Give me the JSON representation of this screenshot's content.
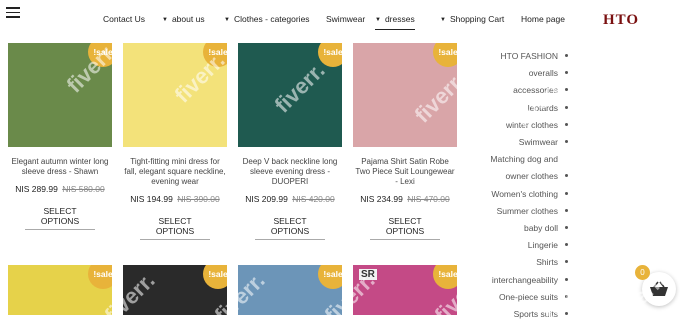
{
  "nav": {
    "contact": "Contact Us",
    "about": "about us",
    "categories": "Clothes - categories",
    "swimwear": "Swimwear",
    "dresses": "dresses",
    "cart": "Shopping Cart",
    "home": "Home page",
    "logo": "HTO"
  },
  "sale_label": "!sale",
  "products": [
    {
      "title": "Elegant autumn winter long sleeve dress - Shawn",
      "price": "NIS 289.99",
      "old_price": "NIS 580.00",
      "button": "SELECT OPTIONS",
      "image_color": "#6a8a4a"
    },
    {
      "title": "Tight-fitting mini dress for fall, elegant square neckline, evening wear",
      "price": "NIS 194.99",
      "old_price": "NIS 390.00",
      "button": "SELECT OPTIONS",
      "image_color": "#f3e27a"
    },
    {
      "title": "Deep V back neckline long sleeve evening dress - DUOPERI",
      "price": "NIS 209.99",
      "old_price": "NIS 420.00",
      "button": "SELECT OPTIONS",
      "image_color": "#1f5a50"
    },
    {
      "title": "Pajama Shirt Satin Robe Two Piece Suit Loungewear - Lexi",
      "price": "NIS 234.99",
      "old_price": "NIS 470.00",
      "button": "SELECT OPTIONS",
      "image_color": "#d9a5a8"
    }
  ],
  "products_row2": [
    {
      "image_color": "#e6d24a"
    },
    {
      "image_color": "#2a2a2a"
    },
    {
      "image_color": "#6c95b8"
    },
    {
      "image_color": "#c44a86",
      "brand_text": "SR"
    }
  ],
  "sidebar": [
    "HTO FASHION",
    "overalls",
    "accessories",
    "leotards",
    "winter clothes",
    "Swimwear",
    "Matching dog and",
    "owner clothes",
    "Women's clothing",
    "Summer clothes",
    "baby doll",
    "Lingerie",
    "Shirts",
    "interchangeability",
    "One-piece suits",
    "Sports suits"
  ],
  "cart_count": "0",
  "watermark": "fiverr."
}
